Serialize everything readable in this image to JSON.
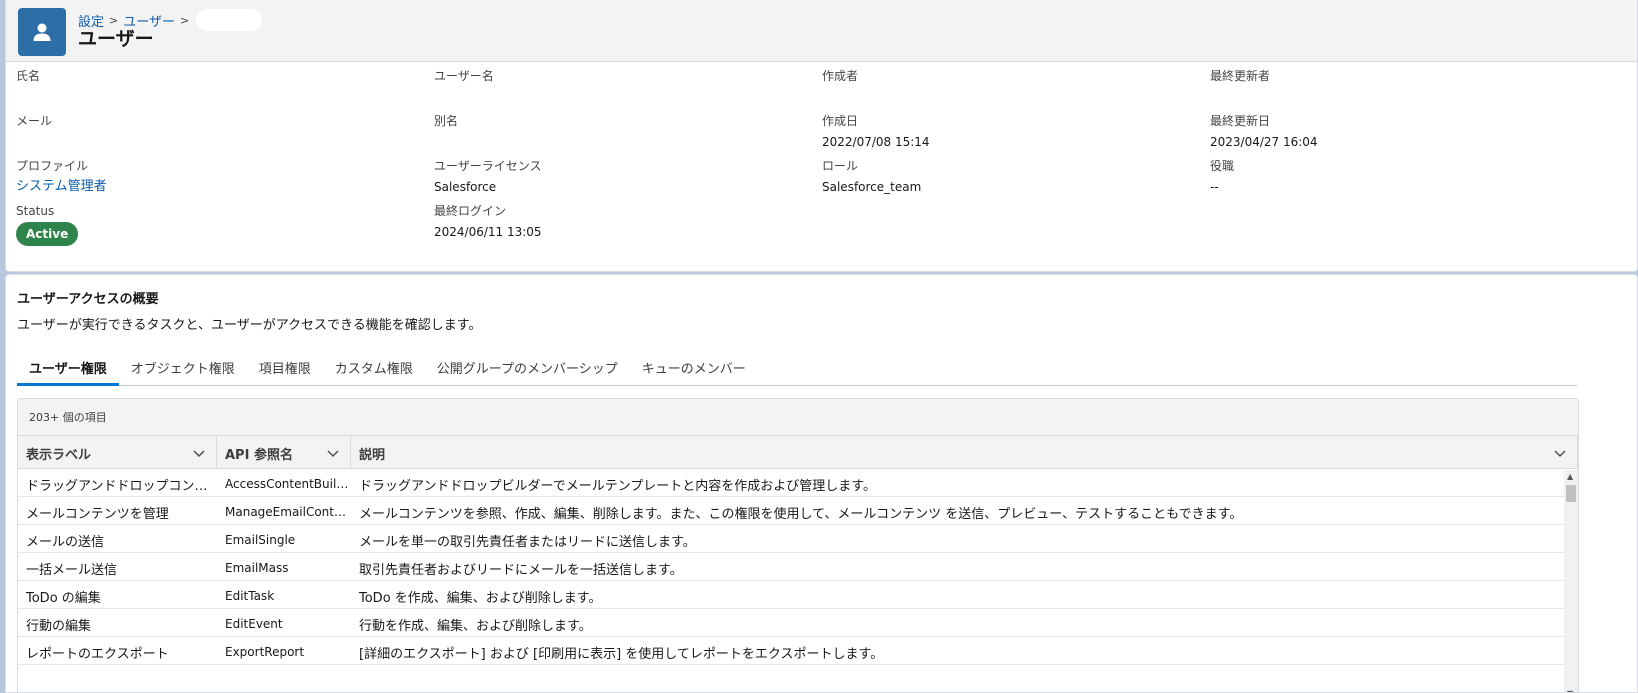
{
  "header": {
    "breadcrumb": [
      "設定",
      "ユーザー"
    ],
    "breadcrumb_sep": ">",
    "title": "ユーザー"
  },
  "fields": {
    "full_name": {
      "label": "氏名",
      "value": ""
    },
    "username": {
      "label": "ユーザー名",
      "value": ""
    },
    "created_by": {
      "label": "作成者",
      "value": ""
    },
    "last_modified_by": {
      "label": "最終更新者",
      "value": ""
    },
    "email": {
      "label": "メール",
      "value": ""
    },
    "alias": {
      "label": "別名",
      "value": ""
    },
    "created_date": {
      "label": "作成日",
      "value": "2022/07/08 15:14"
    },
    "last_modified_date": {
      "label": "最終更新日",
      "value": "2023/04/27 16:04"
    },
    "profile": {
      "label": "プロファイル",
      "value": "システム管理者"
    },
    "user_license": {
      "label": "ユーザーライセンス",
      "value": "Salesforce"
    },
    "role": {
      "label": "ロール",
      "value": "Salesforce_team"
    },
    "title": {
      "label": "役職",
      "value": "--"
    },
    "status": {
      "label": "Status",
      "value": "Active"
    },
    "last_login": {
      "label": "最終ログイン",
      "value": "2024/06/11 13:05"
    }
  },
  "access": {
    "title": "ユーザーアクセスの概要",
    "description": "ユーザーが実行できるタスクと、ユーザーがアクセスできる機能を確認します。",
    "tabs": [
      "ユーザー権限",
      "オブジェクト権限",
      "項目権限",
      "カスタム権限",
      "公開グループのメンバーシップ",
      "キューのメンバー"
    ],
    "active_tab": 0,
    "count_text": "203+ 個の項目",
    "columns": [
      "表示ラベル",
      "API 参照名",
      "説明"
    ],
    "rows": [
      {
        "label": "ドラッグアンドドロップコンテ...",
        "api": "AccessContentBuilder",
        "desc": "ドラッグアンドドロップビルダーでメールテンプレートと内容を作成および管理します。"
      },
      {
        "label": "メールコンテンツを管理",
        "api": "ManageEmailContent",
        "desc": "メールコンテンツを参照、作成、編集、削除します。また、この権限を使用して、メールコンテンツ を送信、プレビュー、テストすることもできます。"
      },
      {
        "label": "メールの送信",
        "api": "EmailSingle",
        "desc": "メールを単一の取引先責任者またはリードに送信します。"
      },
      {
        "label": "一括メール送信",
        "api": "EmailMass",
        "desc": "取引先責任者およびリードにメールを一括送信します。"
      },
      {
        "label": "ToDo の編集",
        "api": "EditTask",
        "desc": "ToDo を作成、編集、および削除します。"
      },
      {
        "label": "行動の編集",
        "api": "EditEvent",
        "desc": "行動を作成、編集、および削除します。"
      },
      {
        "label": "レポートのエクスポート",
        "api": "ExportReport",
        "desc": "[詳細のエクスポート] および [印刷用に表示] を使用してレポートをエクスポートします。"
      }
    ]
  },
  "colors": {
    "brand_blue": "#0176d3",
    "link": "#0b5cab",
    "user_tile": "#2e6ea6",
    "active_badge": "#2e844a"
  },
  "icons": {
    "user_tile": "user-icon",
    "column_menu": "chevron-down-icon",
    "scroll_up": "scroll-up-arrow-icon",
    "scroll_down": "scroll-down-arrow-icon"
  }
}
